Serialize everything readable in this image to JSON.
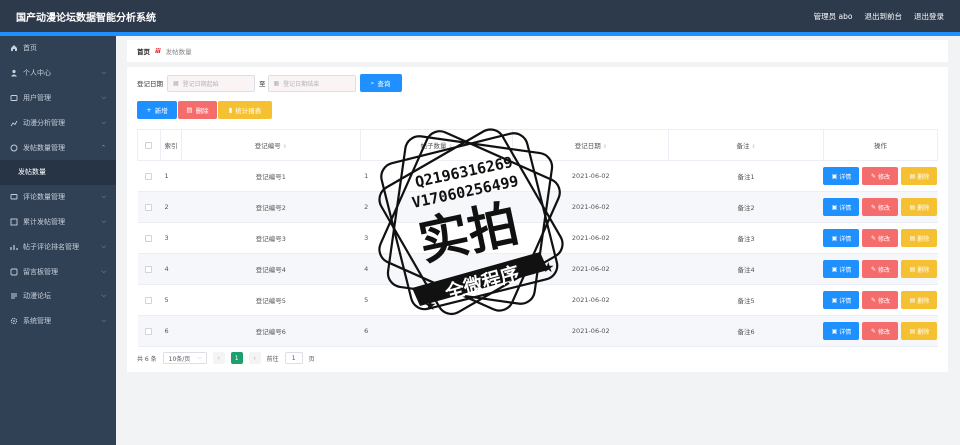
{
  "app": {
    "title": "国产动漫论坛数据智能分析系统"
  },
  "topbar": {
    "admin": "管理员 abo",
    "back": "退出到前台",
    "logout": "退出登录"
  },
  "sidebar": {
    "items": [
      {
        "label": "首页",
        "icon": "home-icon",
        "chevron": false
      },
      {
        "label": "个人中心",
        "icon": "user-icon",
        "chevron": true
      },
      {
        "label": "用户管理",
        "icon": "users-icon",
        "chevron": true
      },
      {
        "label": "动漫分析管理",
        "icon": "chart-icon",
        "chevron": true
      },
      {
        "label": "发帖数量管理",
        "icon": "post-icon",
        "chevron": true,
        "expanded": true
      },
      {
        "label": "评论数量管理",
        "icon": "comment-icon",
        "chevron": true
      },
      {
        "label": "累计发帖管理",
        "icon": "stack-icon",
        "chevron": true
      },
      {
        "label": "帖子评论排名管理",
        "icon": "rank-icon",
        "chevron": true
      },
      {
        "label": "留言板管理",
        "icon": "message-icon",
        "chevron": true
      },
      {
        "label": "动漫论坛",
        "icon": "forum-icon",
        "chevron": true
      },
      {
        "label": "系统管理",
        "icon": "gear-icon",
        "chevron": true
      }
    ],
    "sub_item": "发帖数量"
  },
  "breadcrumb": {
    "home": "首页",
    "sep": "ⅲ",
    "current": "发帖数量"
  },
  "search": {
    "label": "登记日期",
    "start_placeholder": "登记日期起始",
    "to": "至",
    "end_placeholder": "登记日期结束",
    "button": "查询"
  },
  "actions": {
    "add": "新增",
    "delete": "删除",
    "report": "统计报表"
  },
  "table": {
    "headers": [
      "索引",
      "登记编号",
      "帖子数量",
      "登记日期",
      "备注",
      "操作"
    ],
    "rows": [
      {
        "index": "1",
        "code": "登记编号1",
        "count": "1",
        "date": "2021-06-02",
        "note": "备注1"
      },
      {
        "index": "2",
        "code": "登记编号2",
        "count": "2",
        "date": "2021-06-02",
        "note": "备注2"
      },
      {
        "index": "3",
        "code": "登记编号3",
        "count": "3",
        "date": "2021-06-02",
        "note": "备注3"
      },
      {
        "index": "4",
        "code": "登记编号4",
        "count": "4",
        "date": "2021-06-02",
        "note": "备注4"
      },
      {
        "index": "5",
        "code": "登记编号5",
        "count": "5",
        "date": "2021-06-02",
        "note": "备注5"
      },
      {
        "index": "6",
        "code": "登记编号6",
        "count": "6",
        "date": "2021-06-02",
        "note": "备注6"
      }
    ],
    "ops": {
      "detail": "详情",
      "edit": "修改",
      "remove": "删除"
    }
  },
  "pager": {
    "total": "共 6 条",
    "size": "10条/页",
    "current": "1",
    "goto": "前往",
    "goto_value": "1",
    "page_suffix": "页"
  },
  "watermark": {
    "qq": "Q2196316269",
    "v": "V17060256499",
    "main": "实拍",
    "sub": "全微程序"
  },
  "colors": {
    "primary": "#1e90ff",
    "danger": "#f56c6c",
    "warning": "#f5c032",
    "sidebar": "#304156",
    "topbar": "#2d3a4b"
  }
}
